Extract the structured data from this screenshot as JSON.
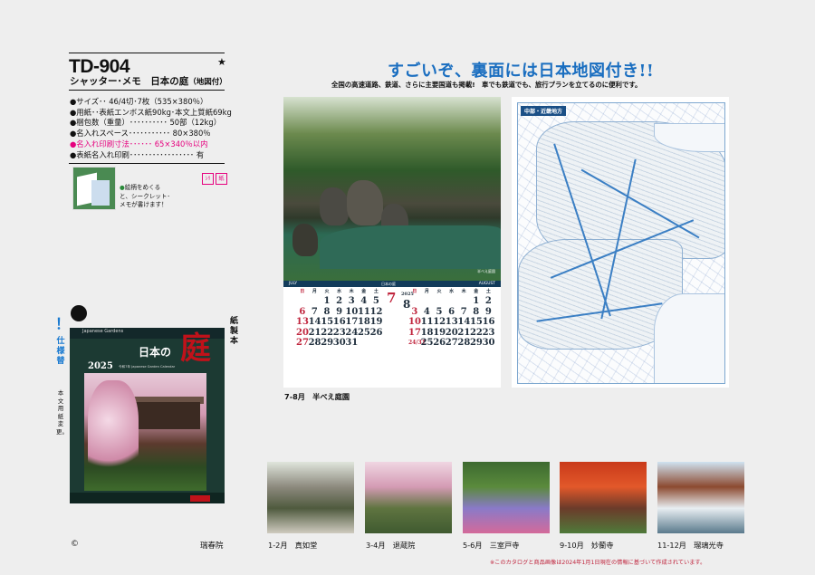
{
  "product": {
    "code": "TD-904",
    "star": "★",
    "name": "シャッター･メモ　日本の庭",
    "name_suffix": "（地図付）"
  },
  "specs": [
    {
      "text": "●サイズ･･ 46/4切･7枚（535×380％）",
      "highlight": false
    },
    {
      "text": "●用紙･･表紙エンボス紙90kg･本文上質紙69kg",
      "highlight": false
    },
    {
      "text": "●梱包数（重量）･･････････ 50部（12kg）",
      "highlight": false
    },
    {
      "text": "●名入れスペース･･･････････ 80×380％",
      "highlight": false
    },
    {
      "text": "●名入れ印刷寸法･･････ 65×340％以内",
      "highlight": true
    },
    {
      "text": "●表紙名入れ印刷･････････････････ 有",
      "highlight": false
    }
  ],
  "tip": {
    "bullet": "●",
    "text": "絵柄をめくると、シークレット･メモが書けます！"
  },
  "badges": [
    "ｼﾘ",
    "紙"
  ],
  "warning": {
    "mark": "！",
    "label": "仕様替",
    "detail": "本文用紙変更。"
  },
  "binding_label": "紙製本",
  "cover": {
    "title_small": "日本の",
    "title_big": "庭",
    "year": "2025",
    "subtitle": "令和7年 Japanese Garden Calendar",
    "topline": "Japanese Gardens"
  },
  "copyright_mark": "©",
  "company": "瑞春院",
  "headline": "すごいぞ、裏面には日本地図付き!!",
  "subheadline": "全国の高速道路、鉄道、さらに主要国道も掲載!　車でも鉄道でも、旅行プランを立てるのに便利です。",
  "calendar": {
    "left_month_label": "JULY",
    "right_month_label": "AUGUST",
    "center_label": "日本の庭",
    "photo_credit": "半べえ庭園",
    "month_left": "7",
    "month_right": "8",
    "year_mini": "2025",
    "weekdays": [
      "日",
      "月",
      "火",
      "水",
      "木",
      "金",
      "土"
    ],
    "left_days": [
      [
        "",
        "",
        "1",
        "2",
        "3",
        "4",
        "5"
      ],
      [
        "6",
        "7",
        "8",
        "9",
        "10",
        "11",
        "12"
      ],
      [
        "13",
        "14",
        "15",
        "16",
        "17",
        "18",
        "19"
      ],
      [
        "20",
        "21",
        "22",
        "23",
        "24",
        "25",
        "26"
      ],
      [
        "27",
        "28",
        "29",
        "30",
        "31",
        "",
        ""
      ]
    ],
    "right_days": [
      [
        "",
        "",
        "",
        "",
        "",
        "1",
        "2"
      ],
      [
        "3",
        "4",
        "5",
        "6",
        "7",
        "8",
        "9"
      ],
      [
        "10",
        "11",
        "12",
        "13",
        "14",
        "15",
        "16"
      ],
      [
        "17",
        "18",
        "19",
        "20",
        "21",
        "22",
        "23"
      ],
      [
        "24/31",
        "25",
        "26",
        "27",
        "28",
        "29",
        "30"
      ]
    ],
    "caption": "7-8月　半べえ庭園"
  },
  "map": {
    "title": "中部・近畿地方"
  },
  "thumbnails": [
    {
      "caption": "1-2月　真如堂",
      "colors": [
        "#dfe5dc",
        "#8d8a7e",
        "#4f5a3e",
        "#cfcbbf"
      ]
    },
    {
      "caption": "3-4月　退蔵院",
      "colors": [
        "#f0d6e2",
        "#d49bb4",
        "#5f7440",
        "#3f5a30"
      ]
    },
    {
      "caption": "5-6月　三室戸寺",
      "colors": [
        "#3d6a30",
        "#5a8a3c",
        "#8a7ac8",
        "#d46a9a"
      ]
    },
    {
      "caption": "9-10月　妙蘭寺",
      "colors": [
        "#c93a1a",
        "#e2582a",
        "#6b3b2a",
        "#4f7a3a"
      ]
    },
    {
      "caption": "11-12月　瑠璃光寺",
      "colors": [
        "#cfe2f0",
        "#8c4a30",
        "#e8eef2",
        "#5a7a8c"
      ]
    }
  ],
  "note": "※このカタログと商品画像は2024年1月1日現在の情報に基づいて作成されています。"
}
